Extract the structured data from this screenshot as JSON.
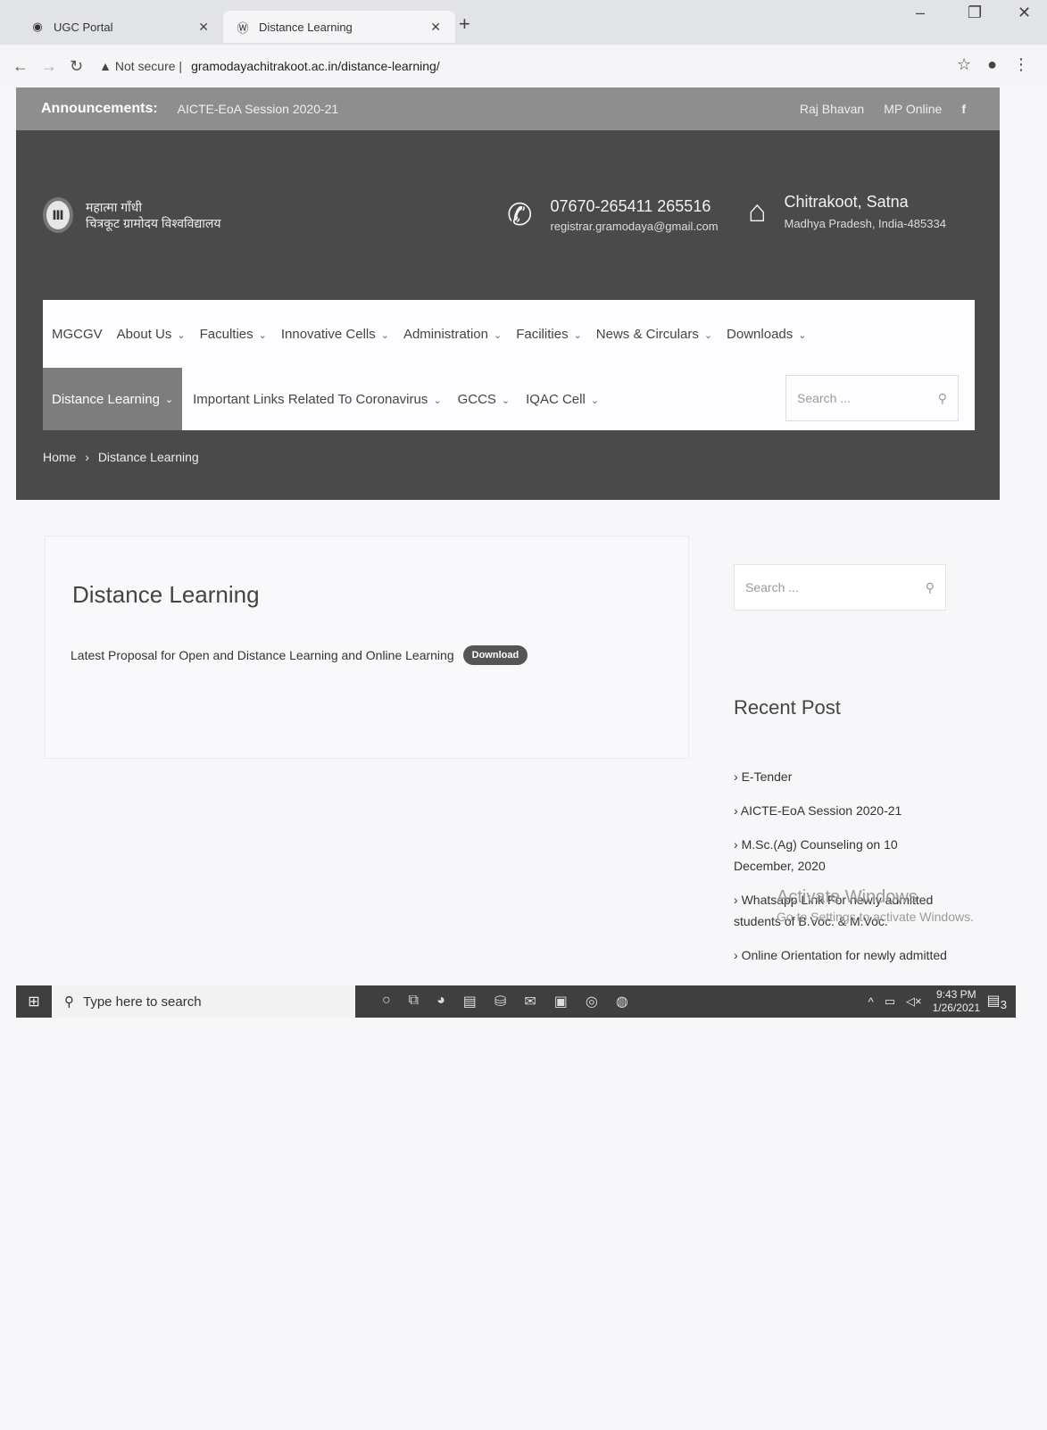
{
  "browser": {
    "tabs": [
      {
        "title": "UGC Portal",
        "icon": "globe-icon"
      },
      {
        "title": "Distance Learning",
        "icon": "wordpress-icon"
      }
    ],
    "url_security": "Not secure",
    "url": "gramodayachitrakoot.ac.in/distance-learning/"
  },
  "announcements": {
    "label": "Announcements:",
    "text": "AICTE-EoA Session 2020-21",
    "links": [
      "Raj Bhavan",
      "MP Online"
    ]
  },
  "header": {
    "logo_line1": "महात्मा गाँधी",
    "logo_line2": "चित्रकूट ग्रामोदय विश्वविद्यालय",
    "phone": "07670-265411 265516",
    "email": "registrar.gramodaya@gmail.com",
    "city": "Chitrakoot, Satna",
    "state": "Madhya Pradesh, India-485334"
  },
  "menu": {
    "row1": [
      "MGCGV",
      "About Us",
      "Faculties",
      "Innovative Cells",
      "Administration",
      "Facilities",
      "News & Circulars",
      "Downloads"
    ],
    "row2_active": "Distance Learning",
    "row2": [
      "Important Links Related To Coronavirus",
      "GCCS",
      "IQAC Cell"
    ],
    "search_placeholder": "Search ..."
  },
  "breadcrumb": {
    "home": "Home",
    "sep": "›",
    "current": "Distance Learning"
  },
  "content": {
    "title": "Distance Learning",
    "proposal": "Latest Proposal for Open and Distance Learning and Online Learning",
    "download_label": "Download"
  },
  "sidebar": {
    "search_placeholder": "Search ...",
    "recent_title": "Recent Post",
    "recent": [
      "E-Tender",
      "AICTE-EoA Session 2020-21",
      "M.Sc.(Ag) Counseling on 10 December, 2020",
      "Whatsapp Link For newly admitted students of B.Voc. & M.Voc.",
      "Online Orientation for newly admitted"
    ]
  },
  "watermark": {
    "title": "Activate Windows",
    "sub": "Go to Settings to activate Windows."
  },
  "taskbar": {
    "search_placeholder": "Type here to search",
    "time": "9:43 PM",
    "date": "1/26/2021",
    "notif_count": "3"
  }
}
